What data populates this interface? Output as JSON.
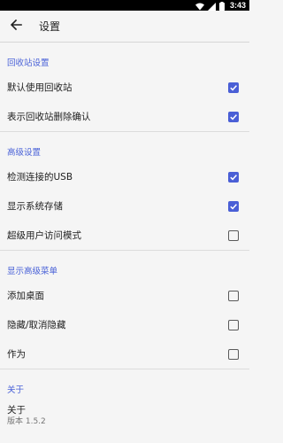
{
  "status_bar": {
    "time": "3:43",
    "icons": [
      "wifi-icon",
      "signal-icon",
      "battery-icon"
    ]
  },
  "toolbar": {
    "title": "设置",
    "back_icon": "arrow-back-icon"
  },
  "sections": [
    {
      "header": "回收站设置",
      "items": [
        {
          "label": "默认使用回收站",
          "checked": true
        },
        {
          "label": "表示回收站删除确认",
          "checked": true
        }
      ]
    },
    {
      "header": "高级设置",
      "items": [
        {
          "label": "检测连接的USB",
          "checked": true
        },
        {
          "label": "显示系统存储",
          "checked": true
        },
        {
          "label": "超级用户访问模式",
          "checked": false
        }
      ]
    },
    {
      "header": "显示高级菜单",
      "items": [
        {
          "label": "添加桌面",
          "checked": false
        },
        {
          "label": "隐藏/取消隐藏",
          "checked": false
        },
        {
          "label": "作为",
          "checked": false
        }
      ]
    }
  ],
  "about": {
    "header": "关于",
    "title": "关于",
    "version": "版本 1.5.2"
  },
  "colors": {
    "accent": "#4a62d8",
    "checkbox_checked": "#4a5fd6"
  }
}
